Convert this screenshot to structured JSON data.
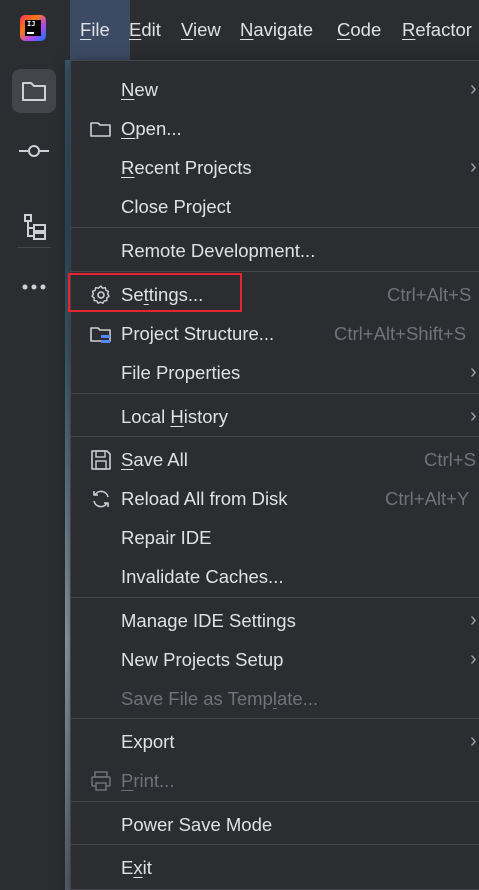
{
  "menubar": {
    "logo_text": "IJ",
    "items": [
      {
        "label_pre": "",
        "label_mn": "F",
        "label_post": "ile"
      },
      {
        "label_pre": "",
        "label_mn": "E",
        "label_post": "dit"
      },
      {
        "label_pre": "",
        "label_mn": "V",
        "label_post": "iew"
      },
      {
        "label_pre": "",
        "label_mn": "N",
        "label_post": "avigate"
      },
      {
        "label_pre": "",
        "label_mn": "C",
        "label_post": "ode"
      },
      {
        "label_pre": "",
        "label_mn": "R",
        "label_post": "efactor"
      }
    ]
  },
  "sidebar": {
    "icons": [
      "folder-icon",
      "commit-icon",
      "structure-icon",
      "more-icon"
    ]
  },
  "file_menu": {
    "items": [
      {
        "pre": "",
        "mn": "N",
        "post": "ew",
        "shortcut": "",
        "submenu": true
      },
      {
        "pre": "",
        "mn": "O",
        "post": "pen...",
        "shortcut": "",
        "icon": "folder-open-icon"
      },
      {
        "pre": "",
        "mn": "R",
        "post": "ecent Projects",
        "shortcut": "",
        "submenu": true
      },
      {
        "pre": "Close Project",
        "mn": "",
        "post": "",
        "shortcut": ""
      },
      {
        "pre": "Remote Development...",
        "mn": "",
        "post": "",
        "shortcut": ""
      },
      {
        "pre": "Se",
        "mn": "t",
        "post": "tings...",
        "shortcut": "Ctrl+Alt+S",
        "icon": "gear-icon"
      },
      {
        "pre": "Project Structure...",
        "mn": "",
        "post": "",
        "shortcut": "Ctrl+Alt+Shift+S",
        "icon": "project-structure-icon"
      },
      {
        "pre": "File Properties",
        "mn": "",
        "post": "",
        "shortcut": "",
        "submenu": true
      },
      {
        "pre": "Local ",
        "mn": "H",
        "post": "istory",
        "shortcut": "",
        "submenu": true
      },
      {
        "pre": "",
        "mn": "S",
        "post": "ave All",
        "shortcut": "Ctrl+S",
        "icon": "save-icon"
      },
      {
        "pre": "Reload All from Disk",
        "mn": "",
        "post": "",
        "shortcut": "Ctrl+Alt+Y",
        "icon": "reload-icon"
      },
      {
        "pre": "Repair IDE",
        "mn": "",
        "post": "",
        "shortcut": ""
      },
      {
        "pre": "Invalidate Caches...",
        "mn": "",
        "post": "",
        "shortcut": ""
      },
      {
        "pre": "Manage IDE Settings",
        "mn": "",
        "post": "",
        "shortcut": "",
        "submenu": true
      },
      {
        "pre": "New Projects Setup",
        "mn": "",
        "post": "",
        "shortcut": "",
        "submenu": true
      },
      {
        "pre": "Save File as Temp",
        "mn": "l",
        "post": "ate...",
        "shortcut": "",
        "disabled": true
      },
      {
        "pre": "Export",
        "mn": "",
        "post": "",
        "shortcut": "",
        "submenu": true
      },
      {
        "pre": "",
        "mn": "P",
        "post": "rint...",
        "shortcut": "",
        "disabled": true,
        "icon": "printer-icon"
      },
      {
        "pre": "Power Save Mode",
        "mn": "",
        "post": "",
        "shortcut": ""
      },
      {
        "pre": "E",
        "mn": "x",
        "post": "it",
        "shortcut": ""
      }
    ]
  },
  "colors": {
    "menu_bg": "#2b2d30",
    "active_menu": "#3d4a63",
    "highlight_border": "#e8242f",
    "text": "#dfe1e5",
    "disabled_text": "#6f737a"
  }
}
